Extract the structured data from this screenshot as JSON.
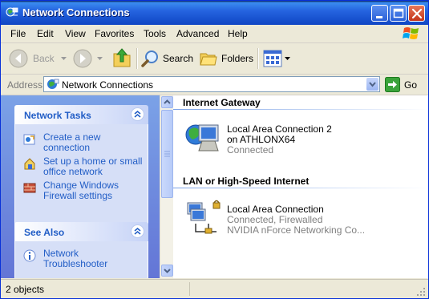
{
  "window": {
    "title": "Network Connections"
  },
  "menu": [
    "File",
    "Edit",
    "View",
    "Favorites",
    "Tools",
    "Advanced",
    "Help"
  ],
  "toolbar": {
    "back_label": "Back",
    "search_label": "Search",
    "folders_label": "Folders"
  },
  "address": {
    "label": "Address",
    "value": "Network Connections",
    "go_label": "Go"
  },
  "tasks_panel": {
    "title": "Network Tasks",
    "items": [
      {
        "label": "Create a new connection",
        "icon": "new-connection-icon"
      },
      {
        "label": "Set up a home or small office network",
        "icon": "home-network-icon"
      },
      {
        "label": "Change Windows Firewall settings",
        "icon": "firewall-icon"
      }
    ]
  },
  "see_also_panel": {
    "title": "See Also",
    "items": [
      {
        "label": "Network Troubleshooter",
        "icon": "info-icon"
      }
    ]
  },
  "groups": [
    {
      "header": "Internet Gateway",
      "items": [
        {
          "name": "Local Area Connection 2 on ATHLONX64",
          "status": "Connected",
          "icon": "gateway-icon"
        }
      ]
    },
    {
      "header": "LAN or High-Speed Internet",
      "items": [
        {
          "name": "Local Area Connection",
          "status": "Connected, Firewalled",
          "device": "NVIDIA nForce Networking Co...",
          "icon": "lan-connection-icon"
        }
      ]
    }
  ],
  "status": {
    "objects": "2 objects"
  },
  "colors": {
    "title_bar": "#2665e0",
    "task_link": "#215dc6",
    "pane_gradient_top": "#7ba2e7",
    "pane_gradient_bottom": "#6375d6"
  }
}
